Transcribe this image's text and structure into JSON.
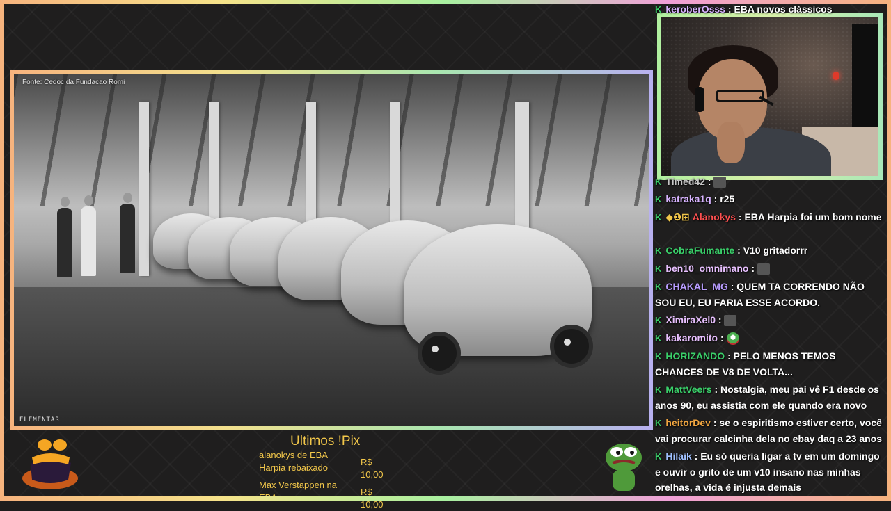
{
  "video": {
    "credit": "Fonte: Cedoc da Fundacao Romi",
    "watermark": "ELEMENTAR"
  },
  "pix": {
    "title": "Ultimos !Pix",
    "entries": [
      {
        "name": "alanokys de EBA Harpia rebaixado",
        "value": "R$ 10,00"
      },
      {
        "name": "Max Verstappen na EBA",
        "value": "R$ 10,00"
      }
    ]
  },
  "chat": {
    "messages": [
      {
        "user": "keroberOsss",
        "color": "#d7b3ff",
        "text": ": EBA novos clássicos"
      },
      {
        "user": "Timed42",
        "color": "#c6c6c6",
        "text": ":",
        "emote": "emote"
      },
      {
        "user": "katraka1q",
        "color": "#d7b3ff",
        "text": ": r25"
      },
      {
        "user": "Alanokys",
        "color": "#ff5050",
        "text": ": EBA Harpia foi um bom nome",
        "badges": "◆❶⊞"
      },
      {
        "user": "CobraFumante",
        "color": "#3ad06a",
        "text": ": V10 gritadorrr"
      },
      {
        "user": "ben10_omnimano",
        "color": "#e8c0ff",
        "text": ":",
        "emote": "emote"
      },
      {
        "user": "CHAKAL_MG",
        "color": "#b89cff",
        "text": ": QUEM TA CORRENDO NÃO SOU EU, EU FARIA ESSE ACORDO."
      },
      {
        "user": "XimiraXel0",
        "color": "#e8c0ff",
        "text": ":",
        "emote": "emote"
      },
      {
        "user": "kakaromito",
        "color": "#e8c0ff",
        "text": ":",
        "emote": "frog"
      },
      {
        "user": "HORIZANDO",
        "color": "#3ad06a",
        "text": ": PELO MENOS TEMOS CHANCES DE V8 DE VOLTA..."
      },
      {
        "user": "MattVeers",
        "color": "#3ad06a",
        "text": ": Nostalgia, meu pai vê F1 desde os anos 90, eu assistia com ele quando era novo"
      },
      {
        "user": "heitorDev",
        "color": "#f2a640",
        "text": ": se o espiritismo estiver certo, você vai procurar calcinha dela no ebay daq a 23 anos"
      },
      {
        "user": "Hilaik",
        "color": "#9fc0ff",
        "text": ": Eu só queria ligar a tv em um domingo e ouvir o grito de um v10 insano nas minhas orelhas, a vida é injusta demais"
      }
    ]
  },
  "colors": {
    "accent": "#f2c74a",
    "chat_badge": "#3ad06a"
  }
}
